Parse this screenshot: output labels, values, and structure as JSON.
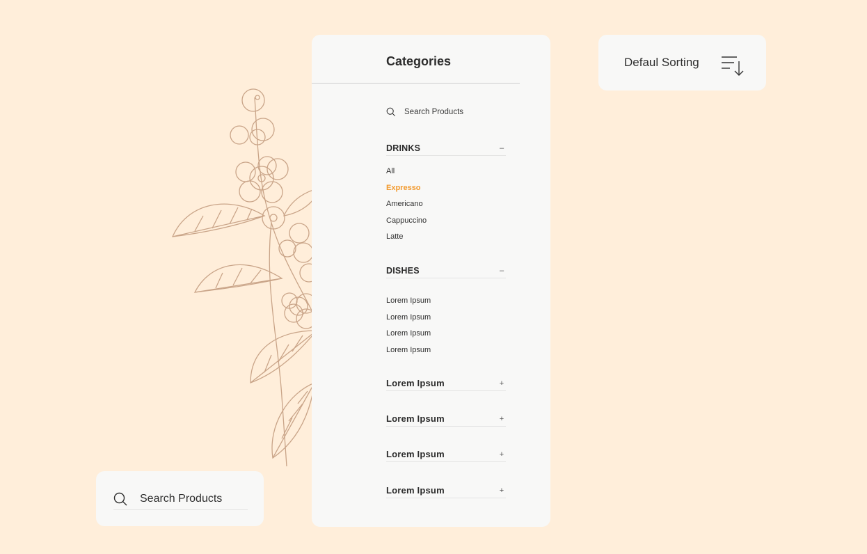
{
  "colors": {
    "background": "#FFEEDA",
    "card": "#F8F8F7",
    "accent": "#F29A2E",
    "illustration": "#C9A488"
  },
  "categories": {
    "title": "Categories",
    "search_placeholder": "Search Products",
    "search_icon": "search-icon",
    "sections": [
      {
        "title": "DRINKS",
        "toggle": "–",
        "expanded": true,
        "items": [
          "All",
          "Expresso",
          "Americano",
          "Cappuccino",
          "Latte"
        ],
        "active_item": "Expresso"
      },
      {
        "title": "DISHES",
        "toggle": "–",
        "expanded": true,
        "items": [
          "Lorem Ipsum",
          "Lorem Ipsum",
          "Lorem Ipsum",
          "Lorem Ipsum"
        ]
      },
      {
        "title": "Lorem Ipsum",
        "toggle": "+",
        "expanded": false
      },
      {
        "title": "Lorem Ipsum",
        "toggle": "+",
        "expanded": false
      },
      {
        "title": "Lorem Ipsum",
        "toggle": "+",
        "expanded": false
      },
      {
        "title": "Lorem Ipsum",
        "toggle": "+",
        "expanded": false
      }
    ]
  },
  "sorting": {
    "label": "Defaul Sorting",
    "icon": "sort-descending-icon"
  },
  "search_card": {
    "placeholder": "Search Products",
    "icon": "search-icon"
  },
  "illustration": {
    "icon": "coffee-branch-illustration"
  }
}
